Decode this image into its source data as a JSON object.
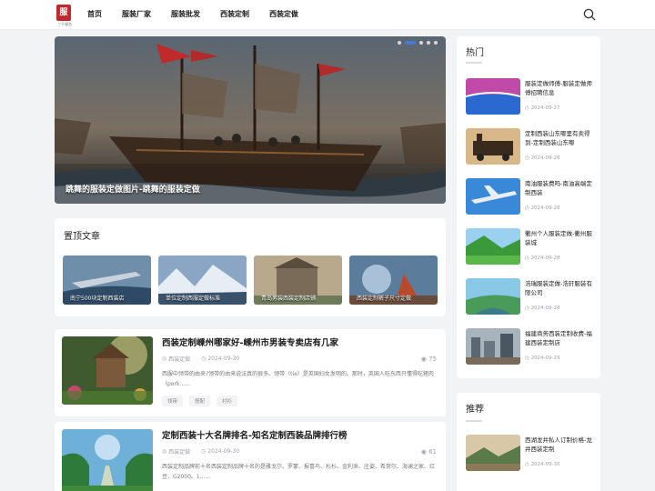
{
  "header": {
    "logo_text": "服",
    "logo_sub": "三千服务",
    "nav": [
      "首页",
      "服装厂家",
      "服装批发",
      "西装定制",
      "西装定做"
    ]
  },
  "hero": {
    "caption": "跳舞的服装定做图片-跳舞的服装定做",
    "slides": 5,
    "active_slide": 2
  },
  "pinned": {
    "title": "置顶文章",
    "items": [
      "南宁500块定制西装店",
      "单位定制西服定做标准",
      "青岛男装西装定制店铺",
      "西装定制裤子尺寸定做"
    ]
  },
  "articles": [
    {
      "title": "西装定制嵊州哪家好-嵊州市男装专卖店有几家",
      "category": "西装定做",
      "date": "2024-09-30",
      "views": "75",
      "excerpt": "西服中领带的由来?领带的由来说法真的很多。领带（tie）是英国妇女发明的。那时，英国人吃东西只懂得吃猪肉（pork......",
      "tags": [
        "领带",
        "搭配",
        "衬衫"
      ]
    },
    {
      "title": "定制西装十大名牌排名-知名定制西装品牌排行榜",
      "category": "西装定做",
      "date": "2024-09-30",
      "views": "61",
      "excerpt": "西装定制品牌前十名西装定制品牌十名的是雅戈尔、罗蒙、报喜鸟、杉杉、金利来、庄姿、希努尔、海澜之家、红豆、G2000。1......",
      "tags": []
    }
  ],
  "sidebar": {
    "hot_title": "热门",
    "hot": [
      {
        "title": "服装定做师傅-服装定做师傅招聘信息",
        "date": "2024-09-27"
      },
      {
        "title": "定制西装山东哪里有卖得到-定制西装山东哪",
        "date": "2024-09-28"
      },
      {
        "title": "南油服装费吗-南油高端定制西装",
        "date": "2024-09-28"
      },
      {
        "title": "衢州个人服装定做-衢州服装城",
        "date": "2024-09-28"
      },
      {
        "title": "浩瑞服装定做-浩轩服装有限公司",
        "date": "2024-09-28"
      },
      {
        "title": "福建商务西装定制收费-福建西装定制店",
        "date": "2024-09-29"
      }
    ],
    "rec_title": "推荐",
    "rec": [
      {
        "title": "西湖龙井私人订制价格-龙井西装定制",
        "date": "2024-09-30"
      }
    ]
  },
  "colors": {
    "accent": "#4a78d8",
    "logo": "#c0282d"
  }
}
